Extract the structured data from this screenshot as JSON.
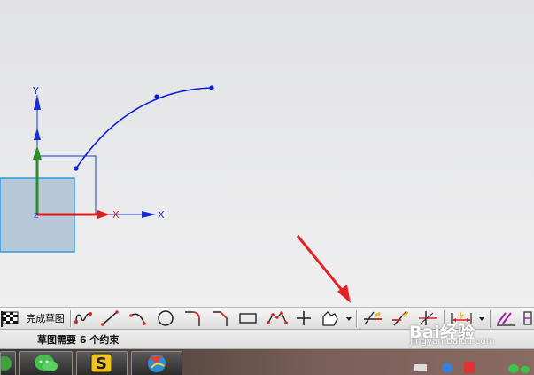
{
  "viewport": {
    "axis_labels": {
      "y_top": "Y",
      "x_right": "X",
      "x_red": "X",
      "z_origin": "Z"
    }
  },
  "toolbar": {
    "finish_label": "完成草图",
    "icons": [
      "finish-sketch-flag-icon",
      "profile-icon",
      "line-icon",
      "arc-icon",
      "circle-icon",
      "fillet-icon",
      "chamfer-icon",
      "rectangle-icon",
      "polygon-icon",
      "point-icon",
      "studio-spline-icon",
      "dropdown-arrow-icon",
      "quick-trim-icon",
      "quick-extend-icon",
      "make-corner-icon",
      "dimension-icon",
      "dropdown-arrow-icon",
      "geometric-constraint-icon",
      "partial-icon"
    ]
  },
  "status": {
    "message": "草图需要 6 个约束"
  },
  "watermark": {
    "logo": "Bai经验",
    "url": "jingyan.baidu.com"
  },
  "colors": {
    "curve": "#0a1fd6",
    "axis_red": "#d42222",
    "axis_green": "#2a8f2a",
    "block": "#b7c8d8",
    "block_border": "#2f9ce0",
    "arrow": "#e52222"
  }
}
